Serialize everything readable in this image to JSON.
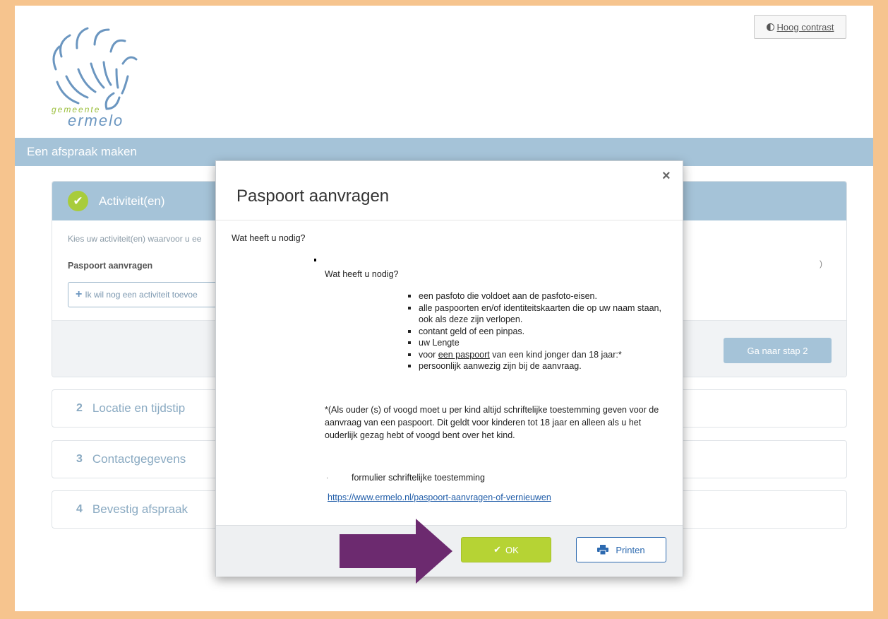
{
  "header": {
    "contrast_label": "Hoog contrast",
    "logo_small": "gemeente",
    "logo_name": "ermelo"
  },
  "banner": {
    "title": "Een afspraak maken"
  },
  "steps": {
    "step1": {
      "title": "Activiteit(en)",
      "intro": "Kies uw activiteit(en) waarvoor u ee",
      "activity": "Paspoort aanvragen",
      "add_label": "Ik wil nog een activiteit toevoe",
      "next_label": "Ga naar stap 2",
      "trailing": ")"
    },
    "step2": {
      "num": "2",
      "label": "Locatie en tijdstip"
    },
    "step3": {
      "num": "3",
      "label": "Contactgegevens"
    },
    "step4": {
      "num": "4",
      "label": "Bevestig afspraak"
    }
  },
  "modal": {
    "title": "Paspoort aanvragen",
    "close": "×",
    "question1": "Wat heeft u nodig?",
    "question2": "Wat heeft u nodig?",
    "requirements": [
      "een pasfoto die voldoet aan de pasfoto-eisen.",
      "alle paspoorten en/of identiteitskaarten die op uw naam staan, ook als deze zijn verlopen.",
      "contant geld of een pinpas.",
      "uw Lengte"
    ],
    "req_child_pre": "voor ",
    "req_child_link": "een paspoort",
    "req_child_post": " van een kind jonger dan 18 jaar:*",
    "req_last": "persoonlijk aanwezig zijn bij de aanvraag.",
    "note": "*(Als ouder (s) of voogd  moet u  per kind altijd schriftelijke toestemming geven voor de aanvraag van een paspoort. Dit geldt voor kinderen tot 18 jaar en alleen als u het ouderlijk gezag hebt of voogd bent over het kind.",
    "form_dot": "·",
    "form_label": "formulier schriftelijke toestemming",
    "link": "https://www.ermelo.nl/paspoort-aanvragen-of-vernieuwen",
    "ok_label": "OK",
    "print_label": "Printen"
  },
  "colors": {
    "frame": "#f6c48e",
    "banner": "#a5c3d8",
    "ok_green": "#b6d334",
    "print_blue": "#2d6ab0",
    "arrow_purple": "#6c2a6f"
  }
}
